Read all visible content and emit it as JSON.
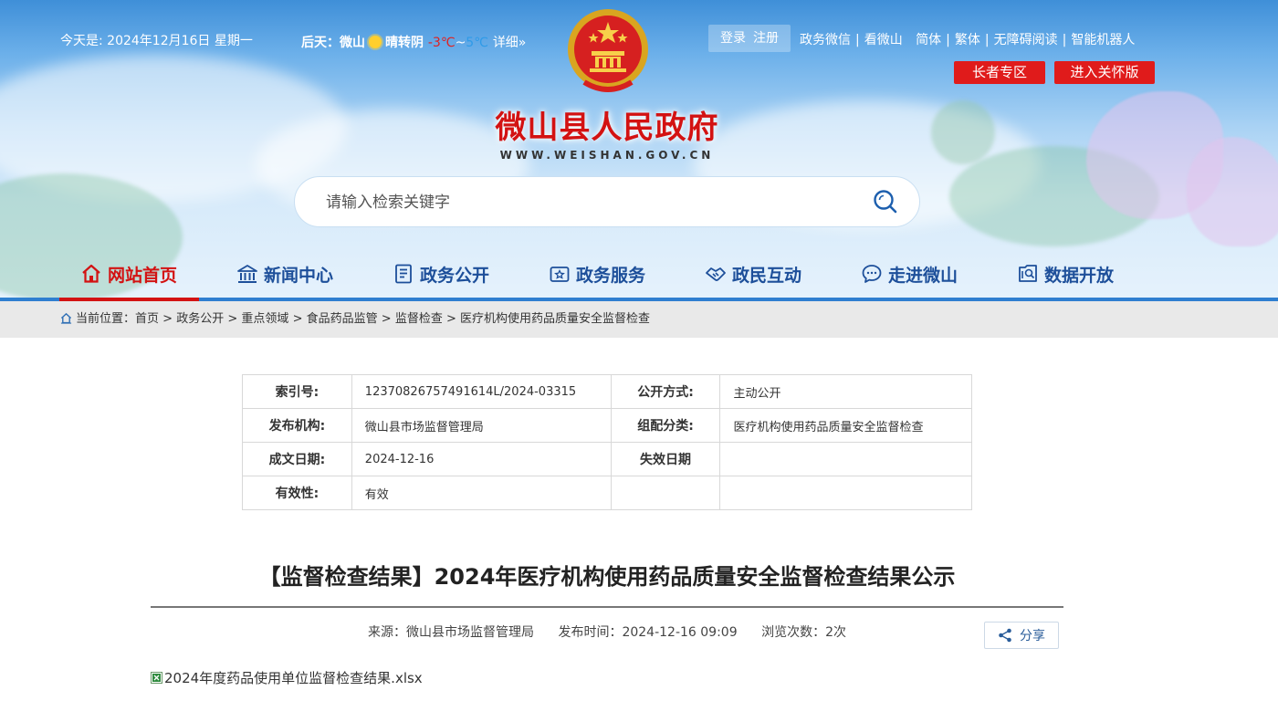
{
  "topbar": {
    "date_text": "今天是:  2024年12月16日  星期一",
    "weather": {
      "day_label": "后天：",
      "city": "微山",
      "condition": "晴转阴",
      "temp_high": "-3℃",
      "tilde": "~",
      "temp_low": "5℃",
      "detail_link": "详细»"
    },
    "login": "登录",
    "register": "注册",
    "links": [
      "政务微信",
      "看微山",
      "简体",
      "繁体",
      "无障碍阅读",
      "智能机器人"
    ],
    "elder_zone": "长者专区",
    "care_mode": "进入关怀版"
  },
  "header": {
    "site_title": "微山县人民政府",
    "site_url": "WWW.WEISHAN.GOV.CN"
  },
  "search": {
    "placeholder": "请输入检索关键字"
  },
  "nav": {
    "items": [
      {
        "label": "网站首页",
        "icon": "home-icon"
      },
      {
        "label": "新闻中心",
        "icon": "building-icon"
      },
      {
        "label": "政务公开",
        "icon": "document-icon"
      },
      {
        "label": "政务服务",
        "icon": "service-icon"
      },
      {
        "label": "政民互动",
        "icon": "handshake-icon"
      },
      {
        "label": "走进微山",
        "icon": "chat-icon"
      },
      {
        "label": "数据开放",
        "icon": "data-icon"
      }
    ],
    "active_index": 0
  },
  "breadcrumb": {
    "prefix": "当前位置：",
    "items": [
      "首页",
      "政务公开",
      "重点领域",
      "食品药品监管",
      "监督检查",
      "医疗机构使用药品质量安全监督检查"
    ],
    "separator": ">"
  },
  "info_table": {
    "rows": [
      [
        {
          "k": "索引号:",
          "v": "12370826757491614L/2024-03315"
        },
        {
          "k": "公开方式:",
          "v": "主动公开"
        }
      ],
      [
        {
          "k": "发布机构:",
          "v": "微山县市场监督管理局"
        },
        {
          "k": "组配分类:",
          "v": "医疗机构使用药品质量安全监督检查"
        }
      ],
      [
        {
          "k": "成文日期:",
          "v": "2024-12-16"
        },
        {
          "k": "失效日期",
          "v": ""
        }
      ],
      [
        {
          "k": "有效性:",
          "v": "有效"
        },
        {
          "k": "",
          "v": ""
        }
      ]
    ]
  },
  "article": {
    "title": "【监督检查结果】2024年医疗机构使用药品质量安全监督检查结果公示",
    "source": "来源：微山县市场监督管理局",
    "publish_time": "发布时间：2024-12-16 09:09",
    "views": "浏览次数：2次",
    "share_label": "分享",
    "attachment": "2024年度药品使用单位监督检查结果.xlsx"
  },
  "colors": {
    "brand_red": "#d31212",
    "nav_blue": "#1d4f9a",
    "banner_blue": "#3f8fd8"
  }
}
